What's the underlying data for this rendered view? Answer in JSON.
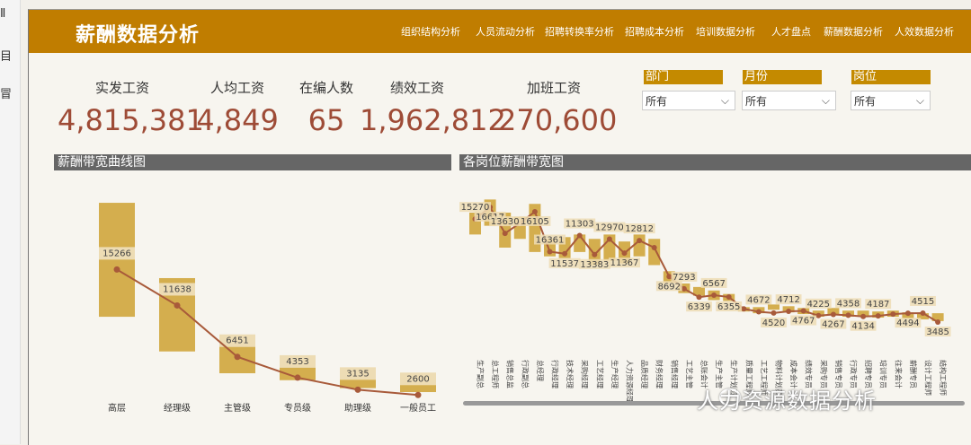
{
  "header": {
    "title": "薪酬数据分析",
    "nav": [
      "组织结构分析",
      "人员流动分析",
      "招聘转换率分析",
      "招聘成本分析",
      "培训数据分析",
      "人才盘点",
      "薪酬数据分析",
      "人效数据分析"
    ]
  },
  "kpis": [
    {
      "label": "实发工资",
      "value": "4,815,381"
    },
    {
      "label": "人均工资",
      "value": "4,849"
    },
    {
      "label": "在编人数",
      "value": "65"
    },
    {
      "label": "绩效工资",
      "value": "1,962,812"
    },
    {
      "label": "加班工资",
      "value": "270,600"
    }
  ],
  "slicers": [
    {
      "title": "部门",
      "value": "所有"
    },
    {
      "title": "月份",
      "value": "所有"
    },
    {
      "title": "岗位",
      "value": "所有"
    }
  ],
  "left_chart_title": "薪酬带宽曲线图",
  "right_chart_title": "各岗位薪酬带宽图",
  "watermark": "人力资源数据分析",
  "colors": {
    "header": "#c07d00",
    "band": "#d4ae4e",
    "band_light": "#eddcb4",
    "line": "#a85a3a",
    "kpi": "#9e4b36"
  },
  "chart_data": [
    {
      "type": "bar",
      "title": "薪酬带宽曲线图",
      "categories": [
        "高层",
        "经理级",
        "主管级",
        "专员级",
        "助理级",
        "一般员工"
      ],
      "low": [
        9500,
        6000,
        3800,
        3100,
        2300,
        1900
      ],
      "high": [
        21000,
        13400,
        7300,
        4900,
        3500,
        2800
      ],
      "series": [
        {
          "values": [
            15266,
            11638,
            6451,
            4353,
            3135,
            2600
          ]
        }
      ],
      "labels": [
        "15266",
        "11638",
        "6451",
        "4353",
        "3135",
        "2600"
      ],
      "ylim": [
        0,
        22000
      ]
    },
    {
      "type": "bar",
      "title": "各岗位薪酬带宽图",
      "categories": [
        "生产副总",
        "总工程师",
        "销售总监",
        "行政副总",
        "总经理",
        "行政经理",
        "技术经理",
        "采购经理",
        "工艺经理",
        "生产经理",
        "人力资源经理",
        "品质经理",
        "财务经理",
        "销售经理",
        "工艺主管",
        "总账会计",
        "生产主管",
        "生产计划员",
        "质量工程师",
        "工艺工程师",
        "物料计划员",
        "成本会计",
        "绩效专员",
        "采购专员",
        "销售专员",
        "行政专员",
        "招聘专员",
        "培训专员",
        "往来会计",
        "薪酬专员",
        "设计工程师",
        "结构工程师"
      ],
      "low": [
        13500,
        14500,
        12000,
        13000,
        11500,
        11000,
        10800,
        11500,
        10000,
        10500,
        10200,
        11000,
        10000,
        8000,
        6800,
        6500,
        6000,
        5900,
        4700,
        4500,
        4900,
        4600,
        4400,
        4100,
        4400,
        4100,
        4100,
        4000,
        4100,
        3900,
        3800,
        3600
      ],
      "high": [
        16000,
        17500,
        16000,
        15500,
        17000,
        13000,
        13200,
        13500,
        13000,
        13500,
        12700,
        13500,
        13000,
        9300,
        7900,
        7500,
        7100,
        6700,
        5200,
        5200,
        5500,
        5300,
        5100,
        4800,
        5100,
        4800,
        4800,
        4700,
        4800,
        4600,
        4500,
        4500
      ],
      "series": [
        {
          "values": [
            15270,
            16617,
            13630,
            14800,
            16105,
            11537,
            11303,
            13383,
            11200,
            12970,
            11367,
            12812,
            12000,
            8692,
            7293,
            6339,
            6567,
            6355,
            5000,
            4672,
            4520,
            4712,
            4767,
            4225,
            4358,
            4267,
            4134,
            4187,
            4400,
            4494,
            4515,
            3485
          ]
        }
      ],
      "labels": [
        {
          "i": 0,
          "t": "15270"
        },
        {
          "i": 1,
          "t": "16617"
        },
        {
          "i": 2,
          "t": "13630"
        },
        {
          "i": 4,
          "t": "16105"
        },
        {
          "i": 5,
          "t": "16361"
        },
        {
          "i": 6,
          "t": "11537"
        },
        {
          "i": 7,
          "t": "11303"
        },
        {
          "i": 8,
          "t": "13383"
        },
        {
          "i": 9,
          "t": "12970"
        },
        {
          "i": 10,
          "t": "11367"
        },
        {
          "i": 11,
          "t": "12812"
        },
        {
          "i": 13,
          "t": "8692"
        },
        {
          "i": 14,
          "t": "7293"
        },
        {
          "i": 15,
          "t": "6339"
        },
        {
          "i": 16,
          "t": "6567"
        },
        {
          "i": 17,
          "t": "6355"
        },
        {
          "i": 19,
          "t": "4672"
        },
        {
          "i": 20,
          "t": "4520"
        },
        {
          "i": 21,
          "t": "4712"
        },
        {
          "i": 22,
          "t": "4767"
        },
        {
          "i": 23,
          "t": "4225"
        },
        {
          "i": 24,
          "t": "4267"
        },
        {
          "i": 25,
          "t": "4358"
        },
        {
          "i": 26,
          "t": "4134"
        },
        {
          "i": 27,
          "t": "4187"
        },
        {
          "i": 29,
          "t": "4494"
        },
        {
          "i": 30,
          "t": "4515"
        },
        {
          "i": 31,
          "t": "3485"
        }
      ],
      "ylim": [
        0,
        20000
      ]
    }
  ]
}
